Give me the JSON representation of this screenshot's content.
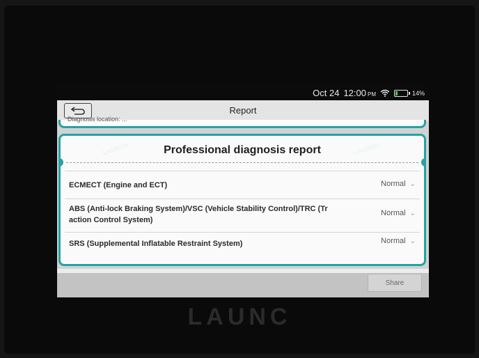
{
  "status_bar": {
    "date": "Oct 24",
    "time": "12:00",
    "ampm": "PM",
    "battery": "14%"
  },
  "header": {
    "title": "Report"
  },
  "top_card": {
    "text": "Diagnosis location: ..."
  },
  "report": {
    "heading": "Professional diagnosis report",
    "rows": [
      {
        "label": "ECMECT (Engine and ECT)",
        "status": "Normal"
      },
      {
        "label": "ABS (Anti-lock Braking System)/VSC (Vehicle Stability Control)/TRC (Tr",
        "label2": "action Control System)",
        "status": "Normal"
      },
      {
        "label": "SRS (Supplemental Inflatable Restraint System)",
        "status": "Normal"
      }
    ]
  },
  "footer": {
    "share_label": "Share"
  },
  "device": {
    "brand": "LAUNC"
  },
  "colors": {
    "accent": "#27a1a4",
    "battery": "#3fcf52"
  }
}
